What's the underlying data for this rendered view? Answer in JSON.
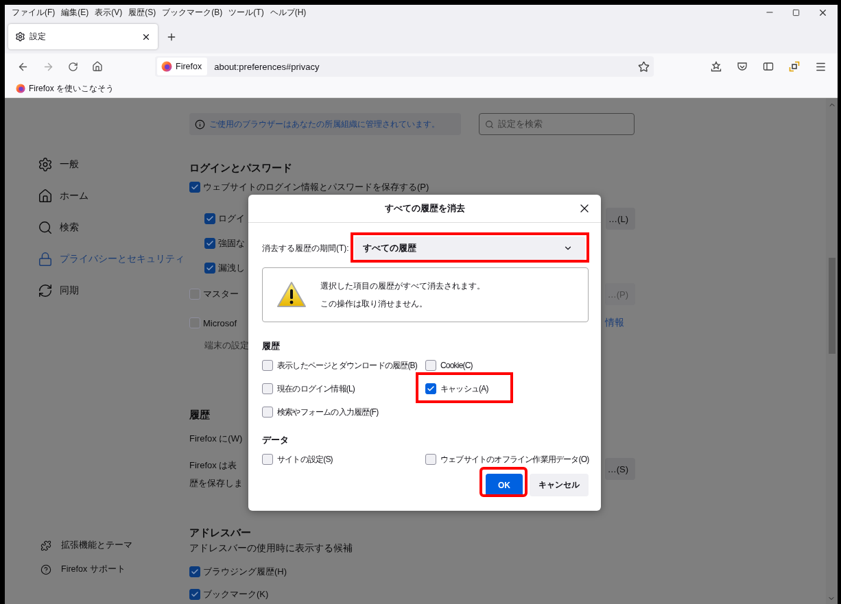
{
  "menu_bar": [
    "ファイル(F)",
    "編集(E)",
    "表示(V)",
    "履歴(S)",
    "ブックマーク(B)",
    "ツール(T)",
    "ヘルプ(H)"
  ],
  "tabs": [
    {
      "label": "設定",
      "selected": true
    }
  ],
  "address_bar": {
    "site_label": "Firefox",
    "url": "about:preferences#privacy"
  },
  "bookmarks": [
    {
      "label": "Firefox を使いこなそう"
    }
  ],
  "sidebar": {
    "items": [
      {
        "label": "一般",
        "selected": false
      },
      {
        "label": "ホーム",
        "selected": false
      },
      {
        "label": "検索",
        "selected": false
      },
      {
        "label": "プライバシーとセキュリティ",
        "selected": true
      },
      {
        "label": "同期",
        "selected": false
      }
    ],
    "footer": [
      {
        "label": "拡張機能とテーマ"
      },
      {
        "label": "Firefox サポート"
      }
    ]
  },
  "notice": "ご使用のブラウザーはあなたの所属組織に管理されています。",
  "search": {
    "placeholder": "設定を検索"
  },
  "logins": {
    "heading": "ログインとパスワード",
    "options": [
      {
        "label": "ウェブサイトのログイン情報とパスワードを保存する(P)",
        "checked": true,
        "children": [
          {
            "label": "ログイ",
            "checked": true,
            "button": "…(L)"
          },
          {
            "label": "強固な",
            "checked": true
          },
          {
            "label": "漏洩し",
            "checked": true
          }
        ]
      },
      {
        "label": "マスター",
        "checked": false,
        "button": "…(P)"
      },
      {
        "label": "Microsof",
        "checked": false,
        "link": "情報"
      }
    ],
    "note": "端末の設定"
  },
  "history": {
    "heading": "履歴",
    "line": "Firefox に(W)",
    "paragraph": [
      "Firefox は表",
      "歴を保存しま"
    ],
    "button": "…(S)"
  },
  "address_section": {
    "heading": "アドレスバー",
    "description": "アドレスバーの使用時に表示する候補",
    "options": [
      {
        "label": "ブラウジング履歴(H)",
        "checked": true
      },
      {
        "label": "ブックマーク(K)",
        "checked": true
      }
    ]
  },
  "dialog": {
    "title": "すべての履歴を消去",
    "period": {
      "label": "消去する履歴の期間(T):",
      "value": "すべての履歴",
      "highlighted": true
    },
    "warning": [
      "選択した項目の履歴がすべて消去されます。",
      "この操作は取り消せません。"
    ],
    "history_heading": "履歴",
    "history_options": [
      {
        "label": "表示したページとダウンロードの履歴(B)",
        "checked": false,
        "highlighted": false
      },
      {
        "label": "Cookie(C)",
        "checked": false,
        "highlighted": false
      },
      {
        "label": "現在のログイン情報(L)",
        "checked": false,
        "highlighted": false
      },
      {
        "label": "キャッシュ(A)",
        "checked": true,
        "highlighted": true
      },
      {
        "label": "検索やフォームの入力履歴(F)",
        "checked": false,
        "highlighted": false
      }
    ],
    "data_heading": "データ",
    "data_options": [
      {
        "label": "サイトの設定(S)",
        "checked": false,
        "highlighted": false
      },
      {
        "label": "ウェブサイトのオフライン作業用データ(O)",
        "checked": false,
        "highlighted": false
      }
    ],
    "buttons": [
      {
        "label": "OK",
        "kind": "primary",
        "highlighted": true
      },
      {
        "label": "キャンセル",
        "kind": "secondary",
        "highlighted": false
      }
    ]
  }
}
